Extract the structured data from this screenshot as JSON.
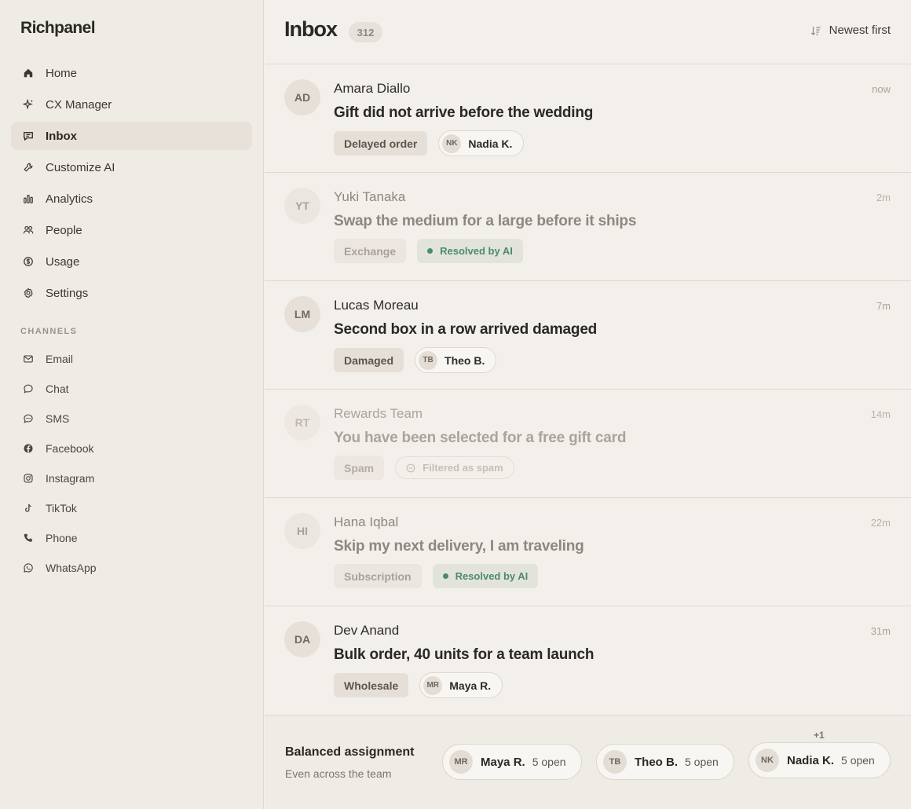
{
  "brand": "Richpanel",
  "nav": [
    {
      "label": "Home",
      "icon": "home-icon"
    },
    {
      "label": "CX Manager",
      "icon": "sparkle-icon"
    },
    {
      "label": "Inbox",
      "icon": "chat-icon",
      "active": true
    },
    {
      "label": "Customize AI",
      "icon": "wrench-icon"
    },
    {
      "label": "Analytics",
      "icon": "bar-chart-icon"
    },
    {
      "label": "People",
      "icon": "people-icon"
    },
    {
      "label": "Usage",
      "icon": "dollar-icon"
    },
    {
      "label": "Settings",
      "icon": "gear-icon"
    }
  ],
  "channels_label": "CHANNELS",
  "channels": [
    {
      "label": "Email",
      "icon": "mail-icon"
    },
    {
      "label": "Chat",
      "icon": "chat-bubble-icon"
    },
    {
      "label": "SMS",
      "icon": "sms-icon"
    },
    {
      "label": "Facebook",
      "icon": "facebook-icon"
    },
    {
      "label": "Instagram",
      "icon": "instagram-icon"
    },
    {
      "label": "TikTok",
      "icon": "tiktok-icon"
    },
    {
      "label": "Phone",
      "icon": "phone-icon"
    },
    {
      "label": "WhatsApp",
      "icon": "whatsapp-icon"
    }
  ],
  "header": {
    "title": "Inbox",
    "count": "312",
    "sort_label": "Newest first"
  },
  "conversations": [
    {
      "initials": "AD",
      "sender": "Amara Diallo",
      "time": "now",
      "subject": "Gift did not arrive before the wedding",
      "tag": "Delayed order",
      "assignee_initials": "NK",
      "assignee": "Nadia K."
    },
    {
      "initials": "YT",
      "sender": "Yuki Tanaka",
      "time": "2m",
      "subject": "Swap the medium for a large before it ships",
      "tag": "Exchange",
      "status": "Resolved by AI"
    },
    {
      "initials": "LM",
      "sender": "Lucas Moreau",
      "time": "7m",
      "subject": "Second box in a row arrived damaged",
      "tag": "Damaged",
      "assignee_initials": "TB",
      "assignee": "Theo B."
    },
    {
      "initials": "RT",
      "sender": "Rewards Team",
      "time": "14m",
      "subject": "You have been selected for a free gift card",
      "tag": "Spam",
      "status": "Filtered as spam"
    },
    {
      "initials": "HI",
      "sender": "Hana Iqbal",
      "time": "22m",
      "subject": "Skip my next delivery, I am traveling",
      "tag": "Subscription",
      "status": "Resolved by AI"
    },
    {
      "initials": "DA",
      "sender": "Dev Anand",
      "time": "31m",
      "subject": "Bulk order, 40 units for a team launch",
      "tag": "Wholesale",
      "assignee_initials": "MR",
      "assignee": "Maya R."
    }
  ],
  "footer": {
    "title": "Balanced assignment",
    "subtitle": "Even across the team",
    "plus": "+1",
    "agents": [
      {
        "initials": "MR",
        "name": "Maya R.",
        "open": "5 open"
      },
      {
        "initials": "TB",
        "name": "Theo B.",
        "open": "5 open"
      },
      {
        "initials": "NK",
        "name": "Nadia K.",
        "open": "5 open"
      }
    ]
  }
}
